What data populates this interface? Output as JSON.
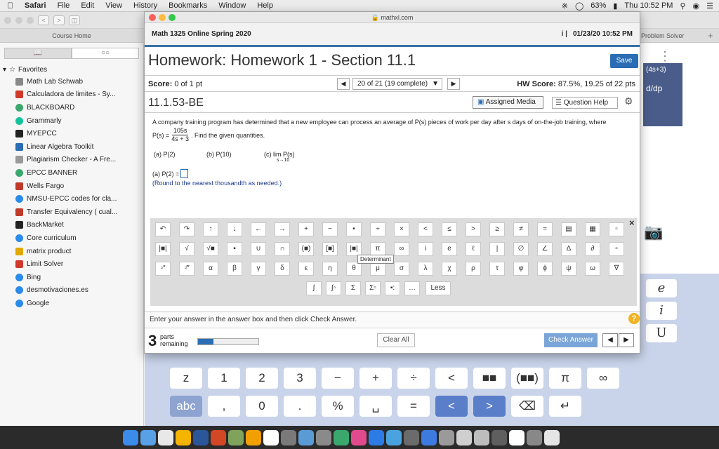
{
  "menubar": {
    "apple": "",
    "app": "Safari",
    "items": [
      "File",
      "Edit",
      "View",
      "History",
      "Bookmarks",
      "Window",
      "Help"
    ],
    "battery": "63%",
    "clock": "Thu 10:52 PM"
  },
  "browser": {
    "url": "mathxl.com",
    "tab_left": "Course Home",
    "tab_right": "Problem Solver"
  },
  "sidebar": {
    "favorites_label": "Favorites",
    "items": [
      {
        "label": "Math Lab Schwab",
        "color": "#888888"
      },
      {
        "label": "Calculadora de limites - Sy...",
        "color": "#d0392b"
      },
      {
        "label": "BLACKBOARD",
        "color": "#3aa76d"
      },
      {
        "label": "Grammarly",
        "color": "#15c39a"
      },
      {
        "label": "MYEPCC",
        "color": "#222222"
      },
      {
        "label": "Linear Algebra Toolkit",
        "color": "#2a6db5"
      },
      {
        "label": "Plagiarism Checker - A Fre...",
        "color": "#999999"
      },
      {
        "label": "EPCC BANNER",
        "color": "#3aa76d"
      },
      {
        "label": "Wells Fargo",
        "color": "#c0392b"
      },
      {
        "label": "NMSU-EPCC codes for cla...",
        "color": "#2a8be8"
      },
      {
        "label": "Transfer Equivalency ( cual...",
        "color": "#c0392b"
      },
      {
        "label": "BackMarket",
        "color": "#222222"
      },
      {
        "label": "Core curriculum",
        "color": "#2a8be8"
      },
      {
        "label": "matrix product",
        "color": "#e0a800"
      },
      {
        "label": "Limit Solver",
        "color": "#d0392b"
      },
      {
        "label": "Bing",
        "color": "#2a8be8"
      },
      {
        "label": "desmotivaciones.es",
        "color": "#2a8be8"
      },
      {
        "label": "Google",
        "color": "#2a8be8"
      }
    ]
  },
  "right_panel": {
    "snippet1": "(4s+3)",
    "snippet2": "d/dp",
    "keys": [
      "e",
      "i",
      "U"
    ]
  },
  "header": {
    "course": "Math 1325 Online Spring 2020",
    "info": "i  |",
    "date": "01/23/20 10:52 PM"
  },
  "homework": {
    "title": "Homework: Homework 1 - Section 11.1",
    "save": "Save",
    "score_label": "Score:",
    "score_value": "0 of 1 pt",
    "question_select": "20 of 21 (19 complete)",
    "hw_score_label": "HW Score:",
    "hw_score_value": "87.5%, 19.25 of 22 pts",
    "question_id": "11.1.53-BE",
    "assigned_media": "Assigned Media",
    "question_help": "Question Help"
  },
  "question": {
    "text": "A company training program has determined that a new employee can process an average of P(s) pieces of work per day after s days of on-the-job training, where",
    "ps_lhs": "P(s) =",
    "numerator": "105s",
    "denominator": "4s + 3",
    "find_text": ". Find the given quantities.",
    "part_a": "(a) P(2)",
    "part_b": "(b) P(10)",
    "part_c": "(c)  lim  P(s)",
    "part_c_sub": "s→10",
    "answer_prompt": "(a) P(2) =",
    "hint": "(Round to the nearest thousandth as needed.)"
  },
  "palette": {
    "row1": [
      "↶",
      "↷",
      "↑",
      "↓",
      "←",
      "→",
      "+",
      "−",
      "•",
      "÷",
      "×",
      "<",
      "≤",
      ">",
      "≥",
      "≠",
      "=",
      "▤",
      "▦",
      "▫"
    ],
    "row2": [
      "|■|",
      "√",
      "√■",
      "▪",
      "∪",
      "∩",
      "(■)",
      "[■]",
      "|■|",
      "π",
      "∞",
      "i",
      "e",
      "ℓ",
      "|",
      "∅",
      "∠",
      "Δ",
      "∂",
      "▫"
    ],
    "row3": [
      "▫″",
      "▫‴",
      "α",
      "β",
      "γ",
      "δ",
      "ε",
      "η",
      "θ",
      "μ",
      "σ",
      "λ",
      "χ",
      "ρ",
      "τ",
      "φ",
      "ϕ",
      "ψ",
      "ω",
      "∇"
    ],
    "row4": [
      "∫",
      "∫▫",
      "Σ",
      "Σ▫",
      "▪:",
      "…"
    ],
    "less": "Less",
    "close": "×",
    "tooltip": "Determinant"
  },
  "footer": {
    "instruction": "Enter your answer in the answer box and then click Check Answer.",
    "help": "?",
    "parts_count": "3",
    "parts_label": "parts",
    "remaining_label": "remaining",
    "progress": 0.25,
    "clear_all": "Clear All",
    "check_answer": "Check Answer"
  },
  "bg_keyboard": {
    "row1": [
      "z",
      "1",
      "2",
      "3",
      "−",
      "+",
      "÷",
      "<",
      "■■",
      "(■■)",
      "π",
      "∞"
    ],
    "row2": [
      "abc",
      ",",
      "0",
      ".",
      "%",
      "␣",
      "=",
      "<",
      ">",
      "⌫",
      "↵"
    ]
  },
  "colors": {
    "accent": "#2a6db5",
    "header_rule": "#3572a8",
    "keyboard_bg": "#c9d4ea",
    "help_badge": "#f0b323"
  }
}
